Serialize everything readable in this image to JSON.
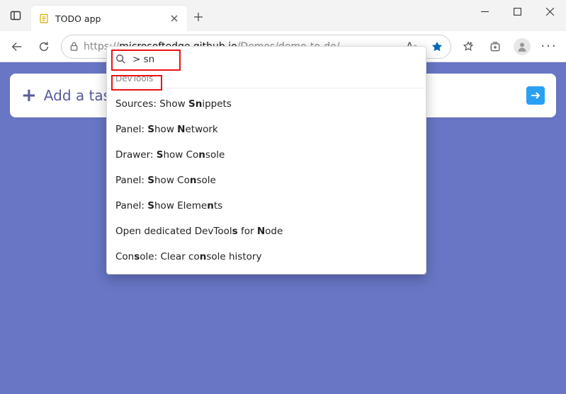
{
  "window": {
    "tab_title": "TODO app",
    "url_prefix": "https://",
    "url_host": "microsoftedge.github.io",
    "url_path": "/Demos/demo-to-do/"
  },
  "page": {
    "add_task_label": "Add a task"
  },
  "command_menu": {
    "query": "> sn",
    "section_label": "DevTools",
    "items": [
      {
        "pre": "Sources: Show ",
        "match": "Sn",
        "post": "ippets"
      },
      {
        "pre": "Panel: ",
        "match": "S",
        "mid": "how ",
        "match2": "N",
        "post": "etwork"
      },
      {
        "pre": "Drawer: ",
        "match": "S",
        "mid": "how Co",
        "match2": "n",
        "post": "sole"
      },
      {
        "pre": "Panel: ",
        "match": "S",
        "mid": "how Co",
        "match2": "n",
        "post": "sole"
      },
      {
        "pre": "Panel: ",
        "match": "S",
        "mid": "how Eleme",
        "match2": "n",
        "post": "ts"
      },
      {
        "pre": "Open dedicated DevTool",
        "match": "s",
        "mid": " for ",
        "match2": "N",
        "post": "ode"
      },
      {
        "pre": "Con",
        "match": "s",
        "mid": "ole: Clear co",
        "match2": "n",
        "post": "sole history"
      }
    ]
  }
}
